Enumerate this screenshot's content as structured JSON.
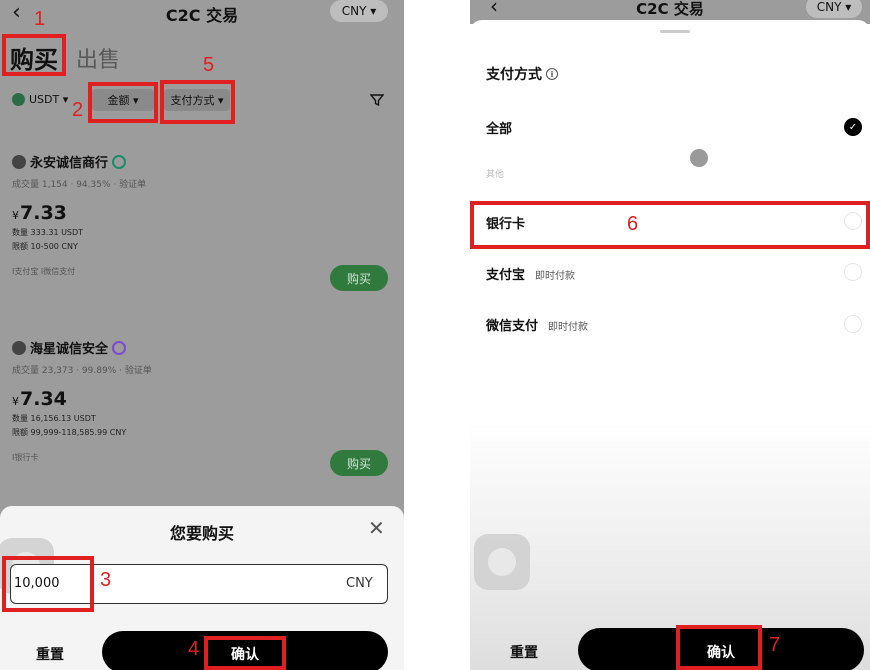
{
  "left": {
    "header": {
      "back_icon": "chevron-left-icon",
      "title": "C2C 交易",
      "currency": "CNY ▾"
    },
    "tabs": {
      "buy": "购买",
      "sell": "出售"
    },
    "filters": {
      "coin": "USDT ▾",
      "amount": "金额 ▾",
      "payment": "支付方式 ▾",
      "funnel_icon": "funnel-icon"
    },
    "merchants": [
      {
        "name": "永安诚信商行",
        "stats": "成交量 1,154 · 94.35% · 验证单",
        "currency_symbol": "¥",
        "price": "7.33",
        "quantity": "数量 333.31 USDT",
        "limit": "限额 10-500 CNY",
        "payments": "I支付宝  I微信支付",
        "button": "购买"
      },
      {
        "name": "海星诚信安全",
        "stats": "成交量 23,373 · 99.89% · 验证单",
        "currency_symbol": "¥",
        "price": "7.34",
        "quantity": "数量 16,156.13 USDT",
        "limit": "限额 99,999-118,585.99 CNY",
        "payments": "I银行卡",
        "button": "购买"
      }
    ],
    "sheet": {
      "title": "您要购买",
      "close": "✕",
      "amount_value": "10,000",
      "unit": "CNY",
      "reset": "重置",
      "confirm": "确认"
    }
  },
  "right": {
    "header": {
      "back_icon": "chevron-left-icon",
      "title": "C2C 交易",
      "currency": "CNY ▾"
    },
    "panel": {
      "title": "支付方式",
      "options": [
        {
          "label": "全部",
          "sub": "",
          "checked": true
        },
        {
          "label": "其他",
          "sub": "",
          "checked": false
        },
        {
          "label": "银行卡",
          "sub": "",
          "checked": false
        },
        {
          "label": "支付宝",
          "sub": "即时付款",
          "checked": false
        },
        {
          "label": "微信支付",
          "sub": "即时付款",
          "checked": false
        }
      ],
      "reset": "重置",
      "confirm": "确认"
    }
  },
  "annotations": [
    "1",
    "2",
    "3",
    "4",
    "5",
    "6",
    "7"
  ],
  "colors": {
    "annotation": "#e02020",
    "buy_button": "#2f7a3c",
    "overlay": "#9c9c9c"
  }
}
